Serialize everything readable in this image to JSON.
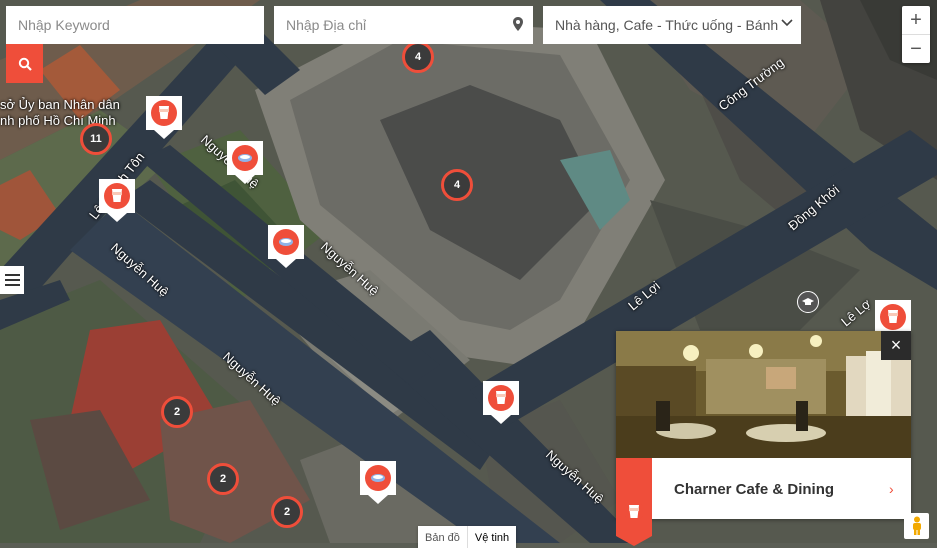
{
  "search": {
    "keyword_placeholder": "Nhập Keyword",
    "address_placeholder": "Nhập Địa chỉ",
    "category_value": "Nhà hàng, Cafe - Thức uống - Bánh"
  },
  "zoom": {
    "in_label": "+",
    "out_label": "−"
  },
  "streets": {
    "cong_truong": "Công Trường",
    "dong_khoi": "Đồng Khởi",
    "le_loi": "Lê Lợi",
    "le_loi_short": "Lê Lợ",
    "nguyen_hue_1": "Nguyễn Huệ",
    "nguyen_hue_2": "Nguyễn Huệ",
    "nguyen_hue_3": "Nguyễn Huệ",
    "nguyen_hue_4": "Nguyễn Huệ",
    "nguyen_hue_5": "Nguyễn Huệ",
    "lam_son": "Lê Thánh Tôn",
    "le_loi_left": "Lê Lợi"
  },
  "poi": {
    "line1": "sở Ủy ban Nhân dân",
    "line2": "nh phố Hồ Chí Minh"
  },
  "clusters": [
    {
      "id": "c1",
      "count": "4"
    },
    {
      "id": "c2",
      "count": "4"
    },
    {
      "id": "c3",
      "count": "11"
    },
    {
      "id": "c4",
      "count": "2"
    },
    {
      "id": "c5",
      "count": "2"
    },
    {
      "id": "c6",
      "count": "2"
    }
  ],
  "card": {
    "title": "Charner Cafe & Dining",
    "close_label": "×",
    "arrow": "›"
  },
  "map_type": {
    "map_label": "Bản đồ",
    "satellite_label": "Vệ tinh"
  },
  "colors": {
    "accent": "#ef4e3a",
    "road": "#2f3a47"
  }
}
